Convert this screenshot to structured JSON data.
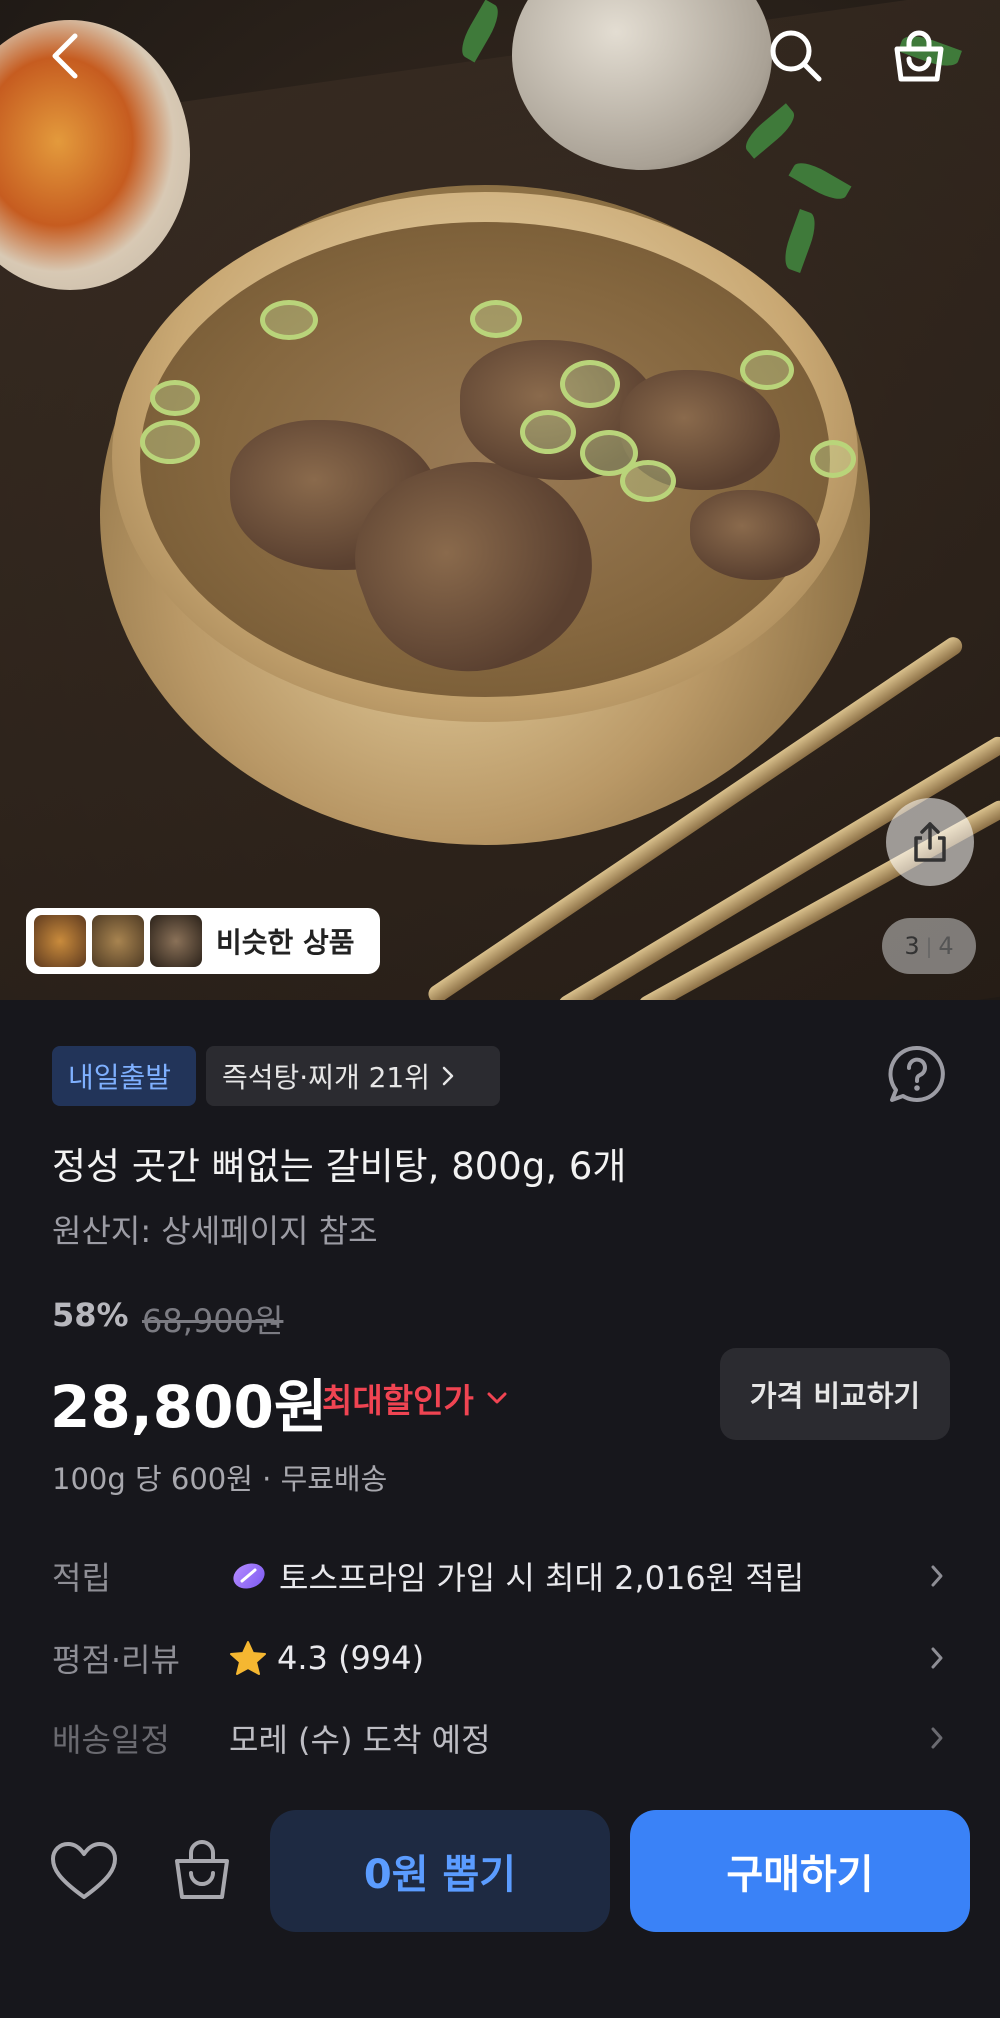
{
  "hero": {
    "similar_label": "비슷한 상품",
    "counter_current": "3",
    "counter_separator": "|",
    "counter_total": "4"
  },
  "badges": {
    "delivery": "내일출발",
    "rank": "즉석탕·찌개 21위"
  },
  "product": {
    "title": "정성 곳간 뼈없는 갈비탕, 800g, 6개",
    "origin": "원산지: 상세페이지 참조",
    "discount_rate": "58%",
    "original_price": "68,900원",
    "price": "28,800원",
    "max_discount_label": "최대할인가",
    "compare_button": "가격 비교하기",
    "unit_info": "100g 당 600원 · 무료배송"
  },
  "info_rows": [
    {
      "label": "적립",
      "value": "토스프라임 가입 시 최대 2,016원 적립",
      "icon": "toss-prime-icon"
    },
    {
      "label": "평점·리뷰",
      "value": "4.3 (994)",
      "icon": "star-icon"
    },
    {
      "label": "배송일정",
      "value": "모레 (수) 도착 예정",
      "icon": ""
    }
  ],
  "bottom": {
    "zero_won_button": "0원 뽑기",
    "buy_button": "구매하기"
  },
  "colors": {
    "background": "#17171c",
    "accent_blue": "#3a82f7",
    "discount_red": "#f04452",
    "star": "#f5b731"
  }
}
